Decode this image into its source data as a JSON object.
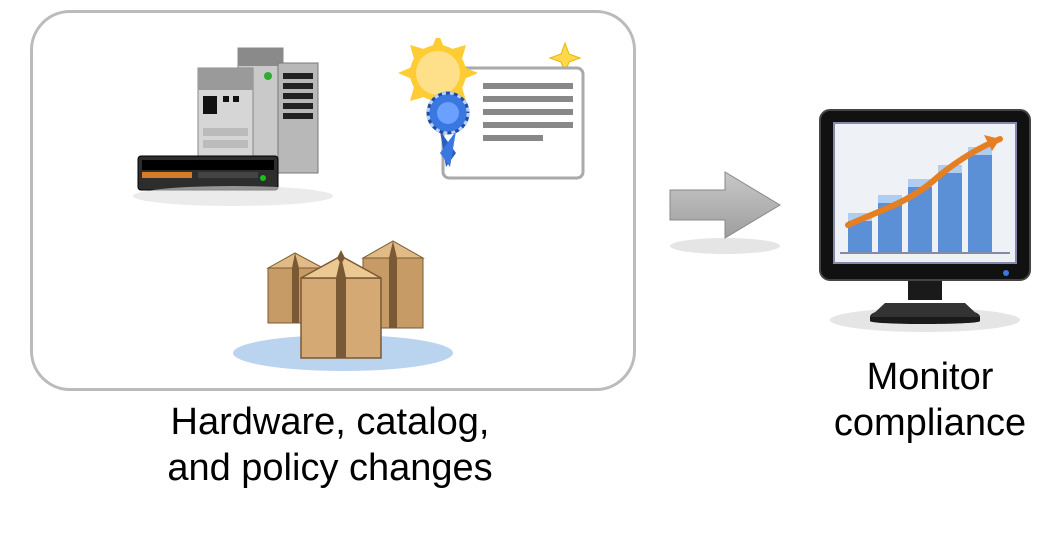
{
  "labels": {
    "left_line1": "Hardware, catalog,",
    "left_line2": "and policy changes",
    "right_line1": "Monitor",
    "right_line2": "compliance"
  },
  "icons": {
    "servers": "server-hardware-icon",
    "certificate": "certificate-badge-icon",
    "packages": "shipping-boxes-icon",
    "arrow": "right-arrow-icon",
    "monitor_chart": "monitor-bar-chart-icon"
  }
}
